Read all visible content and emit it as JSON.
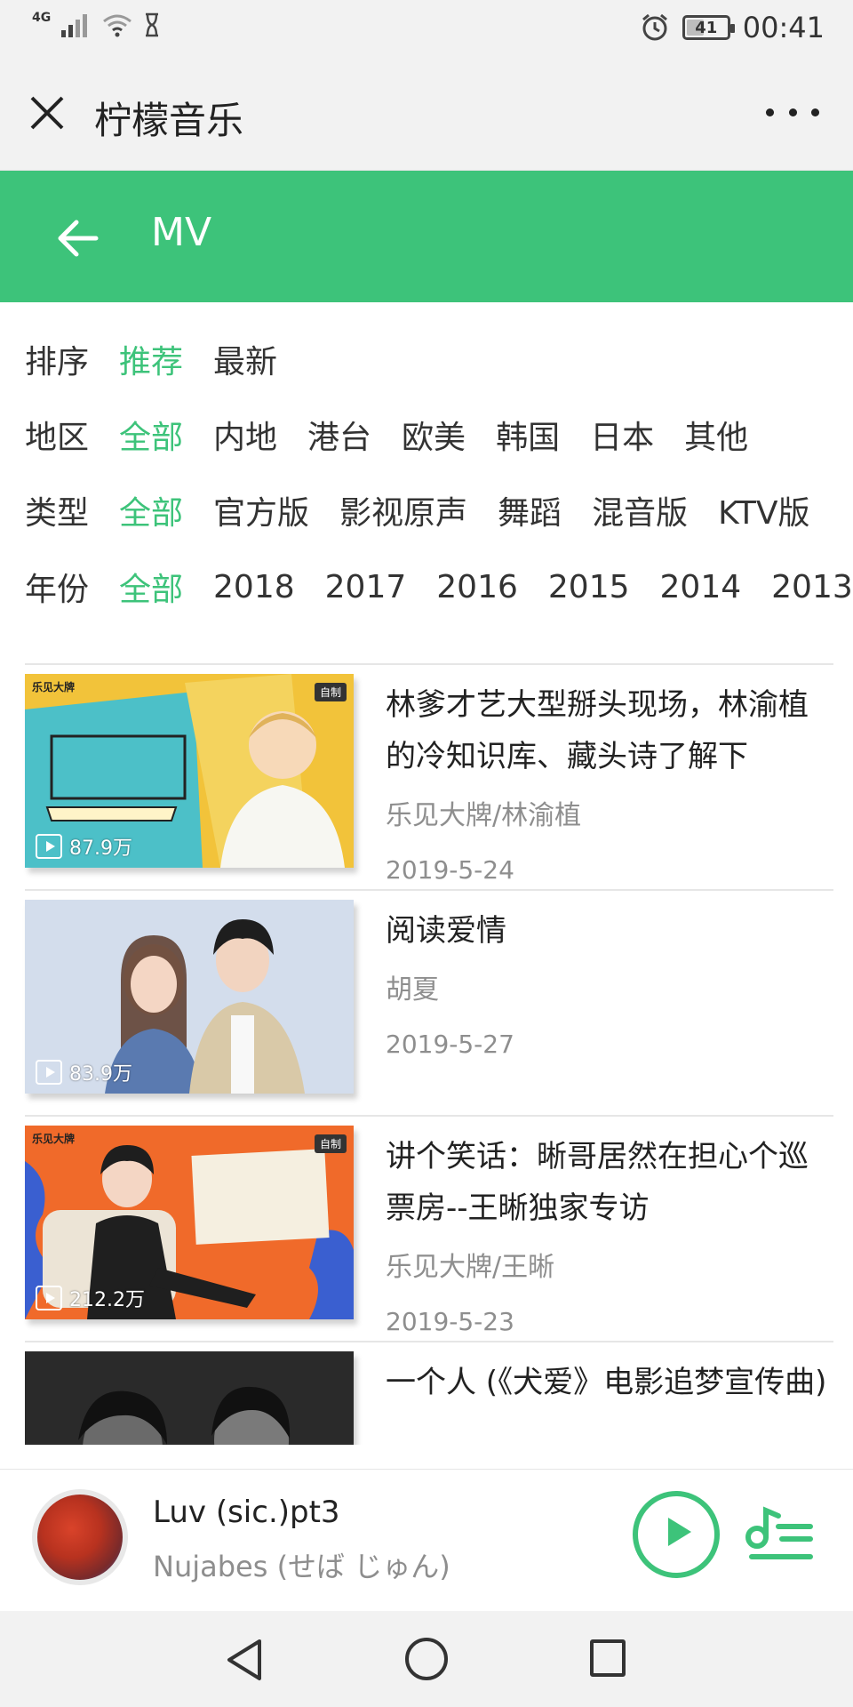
{
  "status_bar": {
    "network": "4G",
    "time": "00:41",
    "battery": "41",
    "battery_level": 0.41
  },
  "title_bar": {
    "title": "柠檬音乐",
    "close_icon": "close-icon",
    "more_icon": "more-icon"
  },
  "header": {
    "title": "MV",
    "back_icon": "arrow-left-icon",
    "color": "#3dc37a"
  },
  "filters": {
    "sort": {
      "label": "排序",
      "options": [
        "推荐",
        "最新"
      ],
      "active": "推荐"
    },
    "region": {
      "label": "地区",
      "options": [
        "全部",
        "内地",
        "港台",
        "欧美",
        "韩国",
        "日本",
        "其他"
      ],
      "active": "全部"
    },
    "type": {
      "label": "类型",
      "options": [
        "全部",
        "官方版",
        "影视原声",
        "舞蹈",
        "混音版",
        "KTV版"
      ],
      "active": "全部"
    },
    "year": {
      "label": "年份",
      "options": [
        "全部",
        "2018",
        "2017",
        "2016",
        "2015",
        "2014",
        "2013"
      ],
      "active": "全部"
    }
  },
  "mv_list": [
    {
      "title": "林爹才艺大型掰头现场，林渝植的冷知识库、藏头诗了解下",
      "artist": "乐见大牌/林渝植",
      "date": "2019-5-24",
      "plays": "87.9万",
      "badge": "自制",
      "brand": "乐见大牌",
      "thumb_colors": [
        "#f2c33a",
        "#4cc0c8"
      ]
    },
    {
      "title": "阅读爱情",
      "artist": "胡夏",
      "date": "2019-5-27",
      "plays": "83.9万",
      "thumb_colors": [
        "#c9d4e6",
        "#e8edf5"
      ]
    },
    {
      "title": "讲个笑话：晰哥居然在担心个巡票房--王晰独家专访",
      "artist": "乐见大牌/王晰",
      "date": "2019-5-23",
      "plays": "212.2万",
      "badge": "自制",
      "brand": "乐见大牌",
      "thumb_colors": [
        "#f06a2a",
        "#3a5fd0"
      ]
    },
    {
      "title": "一个人 (《犬爱》电影追梦宣传曲)",
      "artist": "",
      "date": "",
      "plays": "",
      "thumb_colors": [
        "#2a2a2a",
        "#6a6a6a"
      ]
    }
  ],
  "player": {
    "track_title": "Luv (sic.)pt3",
    "track_artist": "Nujabes (せば じゅん)",
    "play_icon": "play-icon",
    "playlist_icon": "playlist-icon",
    "accent": "#3dc37a"
  },
  "nav_bar": {
    "back_icon": "nav-back-icon",
    "home_icon": "nav-home-icon",
    "recent_icon": "nav-recent-icon"
  }
}
